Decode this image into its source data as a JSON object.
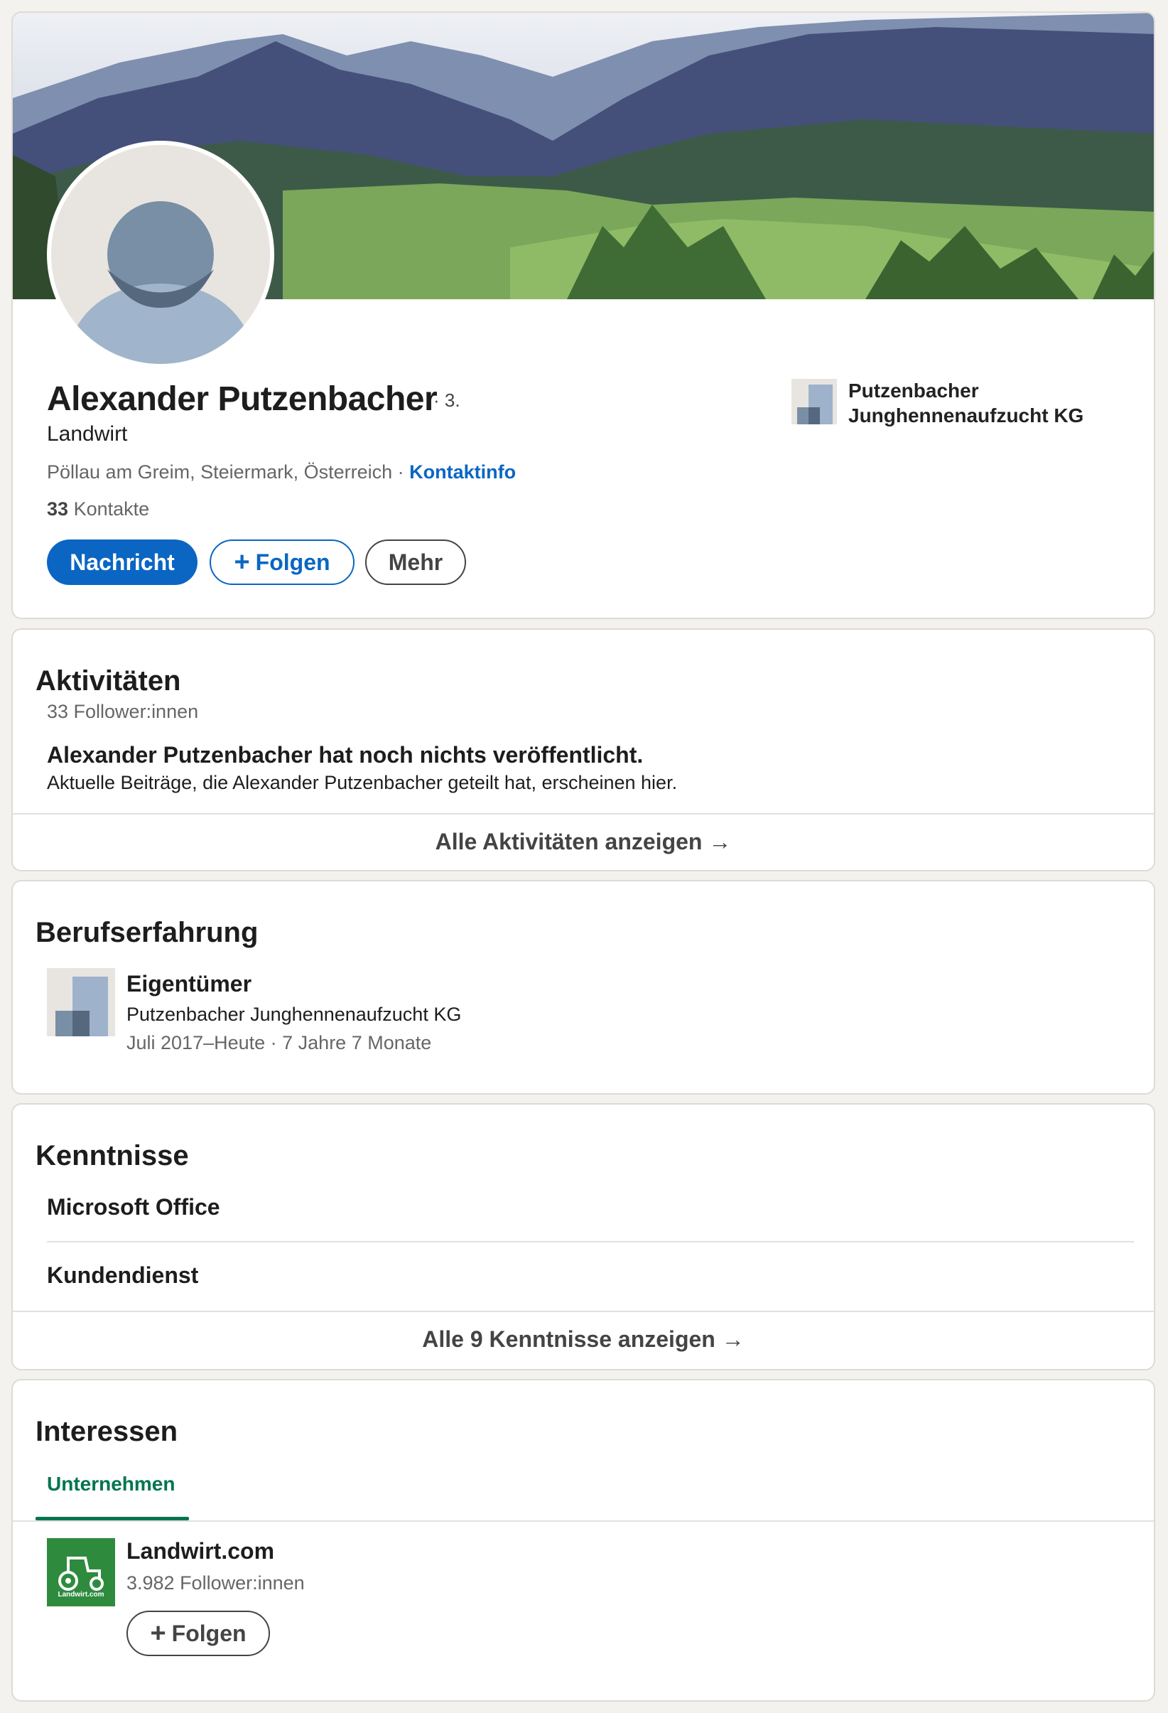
{
  "profile": {
    "name": "Alexander Putzenbacher",
    "degree": "· 3.",
    "headline": "Landwirt",
    "location": "Pöllau am Greim, Steiermark, Österreich ·",
    "contact_info": "Kontaktinfo",
    "connections_count": "33",
    "connections_label": "Kontakte",
    "buttons": {
      "message": "Nachricht",
      "follow": "Folgen",
      "more": "Mehr"
    },
    "current_company": "Putzenbacher Junghennenaufzucht KG"
  },
  "activity": {
    "title": "Aktivitäten",
    "followers": "33 Follower:innen",
    "empty_title": "Alexander Putzenbacher hat noch nichts veröffentlicht.",
    "empty_text": "Aktuelle Beiträge, die Alexander Putzenbacher geteilt hat, erscheinen hier.",
    "show_all": "Alle Aktivitäten anzeigen →"
  },
  "experience": {
    "title": "Berufserfahrung",
    "items": [
      {
        "role": "Eigentümer",
        "company": "Putzenbacher Junghennenaufzucht KG",
        "period": "Juli 2017–Heute · 7 Jahre 7 Monate"
      }
    ]
  },
  "skills": {
    "title": "Kenntnisse",
    "items": [
      "Microsoft Office",
      "Kundendienst"
    ],
    "show_all": "Alle 9 Kenntnisse anzeigen →"
  },
  "interests": {
    "title": "Interessen",
    "tab": "Unternehmen",
    "items": [
      {
        "name": "Landwirt.com",
        "logo_text": "Landwirt.com",
        "followers": "3.982 Follower:innen",
        "follow": "Folgen"
      }
    ]
  },
  "colors": {
    "primary": "#0a66c2",
    "tab_accent": "#01754f",
    "logo_green": "#2e8b3e"
  }
}
